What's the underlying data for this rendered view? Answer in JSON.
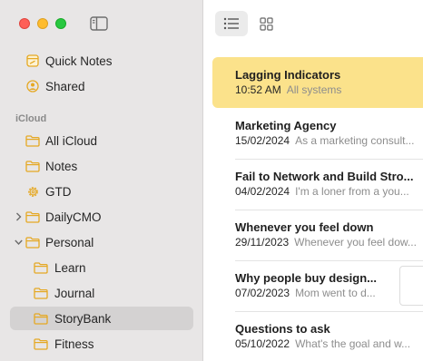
{
  "sidebar": {
    "pinned": [
      {
        "label": "Quick Notes",
        "icon": "quick-notes-icon"
      },
      {
        "label": "Shared",
        "icon": "shared-person-icon"
      }
    ],
    "section_label": "iCloud",
    "folders": [
      {
        "label": "All iCloud",
        "icon": "folder-icon"
      },
      {
        "label": "Notes",
        "icon": "folder-icon"
      },
      {
        "label": "GTD",
        "icon": "gear-icon"
      },
      {
        "label": "DailyCMO",
        "icon": "folder-icon",
        "disclosure": "collapsed"
      },
      {
        "label": "Personal",
        "icon": "folder-icon",
        "disclosure": "expanded"
      },
      {
        "label": "Learn",
        "icon": "folder-icon"
      },
      {
        "label": "Journal",
        "icon": "folder-icon"
      },
      {
        "label": "StoryBank",
        "icon": "folder-icon",
        "selected": true
      },
      {
        "label": "Fitness",
        "icon": "folder-icon"
      }
    ]
  },
  "toolbar": {
    "view_modes": [
      {
        "name": "list",
        "icon": "list-view-icon",
        "active": true
      },
      {
        "name": "gallery",
        "icon": "grid-view-icon",
        "active": false
      }
    ]
  },
  "notes": [
    {
      "title": "Lagging Indicators",
      "date": "10:52 AM",
      "preview": "All systems",
      "selected": true
    },
    {
      "title": "Marketing Agency",
      "date": "15/02/2024",
      "preview": "As a marketing consult..."
    },
    {
      "title": "Fail to Network and Build Stro...",
      "date": "04/02/2024",
      "preview": "I'm a loner from a you..."
    },
    {
      "title": "Whenever you feel down",
      "date": "29/11/2023",
      "preview": "Whenever you feel dow..."
    },
    {
      "title": "Why people buy design...",
      "date": "07/02/2023",
      "preview": "Mom went to d...",
      "has_thumbnail": true
    },
    {
      "title": "Questions to ask",
      "date": "05/10/2022",
      "preview": "What's the goal and w..."
    }
  ],
  "colors": {
    "accent_folder": "#e5a823",
    "selected_note": "#fbe28b",
    "sidebar_bg": "#e8e6e6"
  }
}
